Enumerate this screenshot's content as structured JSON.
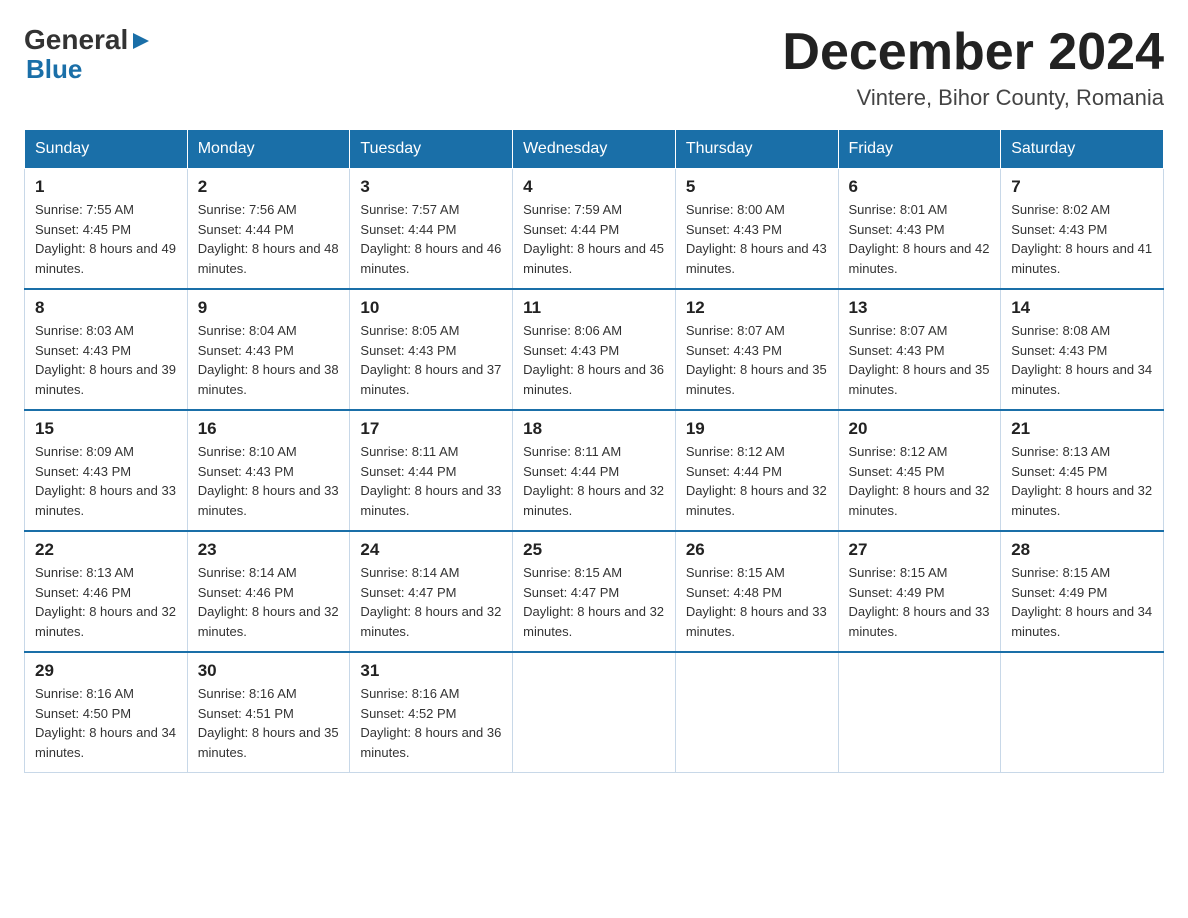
{
  "header": {
    "logo_general": "General",
    "logo_blue": "Blue",
    "month_title": "December 2024",
    "location": "Vintere, Bihor County, Romania"
  },
  "days_of_week": [
    "Sunday",
    "Monday",
    "Tuesday",
    "Wednesday",
    "Thursday",
    "Friday",
    "Saturday"
  ],
  "weeks": [
    [
      {
        "day": "1",
        "sunrise": "7:55 AM",
        "sunset": "4:45 PM",
        "daylight": "8 hours and 49 minutes."
      },
      {
        "day": "2",
        "sunrise": "7:56 AM",
        "sunset": "4:44 PM",
        "daylight": "8 hours and 48 minutes."
      },
      {
        "day": "3",
        "sunrise": "7:57 AM",
        "sunset": "4:44 PM",
        "daylight": "8 hours and 46 minutes."
      },
      {
        "day": "4",
        "sunrise": "7:59 AM",
        "sunset": "4:44 PM",
        "daylight": "8 hours and 45 minutes."
      },
      {
        "day": "5",
        "sunrise": "8:00 AM",
        "sunset": "4:43 PM",
        "daylight": "8 hours and 43 minutes."
      },
      {
        "day": "6",
        "sunrise": "8:01 AM",
        "sunset": "4:43 PM",
        "daylight": "8 hours and 42 minutes."
      },
      {
        "day": "7",
        "sunrise": "8:02 AM",
        "sunset": "4:43 PM",
        "daylight": "8 hours and 41 minutes."
      }
    ],
    [
      {
        "day": "8",
        "sunrise": "8:03 AM",
        "sunset": "4:43 PM",
        "daylight": "8 hours and 39 minutes."
      },
      {
        "day": "9",
        "sunrise": "8:04 AM",
        "sunset": "4:43 PM",
        "daylight": "8 hours and 38 minutes."
      },
      {
        "day": "10",
        "sunrise": "8:05 AM",
        "sunset": "4:43 PM",
        "daylight": "8 hours and 37 minutes."
      },
      {
        "day": "11",
        "sunrise": "8:06 AM",
        "sunset": "4:43 PM",
        "daylight": "8 hours and 36 minutes."
      },
      {
        "day": "12",
        "sunrise": "8:07 AM",
        "sunset": "4:43 PM",
        "daylight": "8 hours and 35 minutes."
      },
      {
        "day": "13",
        "sunrise": "8:07 AM",
        "sunset": "4:43 PM",
        "daylight": "8 hours and 35 minutes."
      },
      {
        "day": "14",
        "sunrise": "8:08 AM",
        "sunset": "4:43 PM",
        "daylight": "8 hours and 34 minutes."
      }
    ],
    [
      {
        "day": "15",
        "sunrise": "8:09 AM",
        "sunset": "4:43 PM",
        "daylight": "8 hours and 33 minutes."
      },
      {
        "day": "16",
        "sunrise": "8:10 AM",
        "sunset": "4:43 PM",
        "daylight": "8 hours and 33 minutes."
      },
      {
        "day": "17",
        "sunrise": "8:11 AM",
        "sunset": "4:44 PM",
        "daylight": "8 hours and 33 minutes."
      },
      {
        "day": "18",
        "sunrise": "8:11 AM",
        "sunset": "4:44 PM",
        "daylight": "8 hours and 32 minutes."
      },
      {
        "day": "19",
        "sunrise": "8:12 AM",
        "sunset": "4:44 PM",
        "daylight": "8 hours and 32 minutes."
      },
      {
        "day": "20",
        "sunrise": "8:12 AM",
        "sunset": "4:45 PM",
        "daylight": "8 hours and 32 minutes."
      },
      {
        "day": "21",
        "sunrise": "8:13 AM",
        "sunset": "4:45 PM",
        "daylight": "8 hours and 32 minutes."
      }
    ],
    [
      {
        "day": "22",
        "sunrise": "8:13 AM",
        "sunset": "4:46 PM",
        "daylight": "8 hours and 32 minutes."
      },
      {
        "day": "23",
        "sunrise": "8:14 AM",
        "sunset": "4:46 PM",
        "daylight": "8 hours and 32 minutes."
      },
      {
        "day": "24",
        "sunrise": "8:14 AM",
        "sunset": "4:47 PM",
        "daylight": "8 hours and 32 minutes."
      },
      {
        "day": "25",
        "sunrise": "8:15 AM",
        "sunset": "4:47 PM",
        "daylight": "8 hours and 32 minutes."
      },
      {
        "day": "26",
        "sunrise": "8:15 AM",
        "sunset": "4:48 PM",
        "daylight": "8 hours and 33 minutes."
      },
      {
        "day": "27",
        "sunrise": "8:15 AM",
        "sunset": "4:49 PM",
        "daylight": "8 hours and 33 minutes."
      },
      {
        "day": "28",
        "sunrise": "8:15 AM",
        "sunset": "4:49 PM",
        "daylight": "8 hours and 34 minutes."
      }
    ],
    [
      {
        "day": "29",
        "sunrise": "8:16 AM",
        "sunset": "4:50 PM",
        "daylight": "8 hours and 34 minutes."
      },
      {
        "day": "30",
        "sunrise": "8:16 AM",
        "sunset": "4:51 PM",
        "daylight": "8 hours and 35 minutes."
      },
      {
        "day": "31",
        "sunrise": "8:16 AM",
        "sunset": "4:52 PM",
        "daylight": "8 hours and 36 minutes."
      },
      null,
      null,
      null,
      null
    ]
  ],
  "labels": {
    "sunrise": "Sunrise:",
    "sunset": "Sunset:",
    "daylight": "Daylight:"
  }
}
